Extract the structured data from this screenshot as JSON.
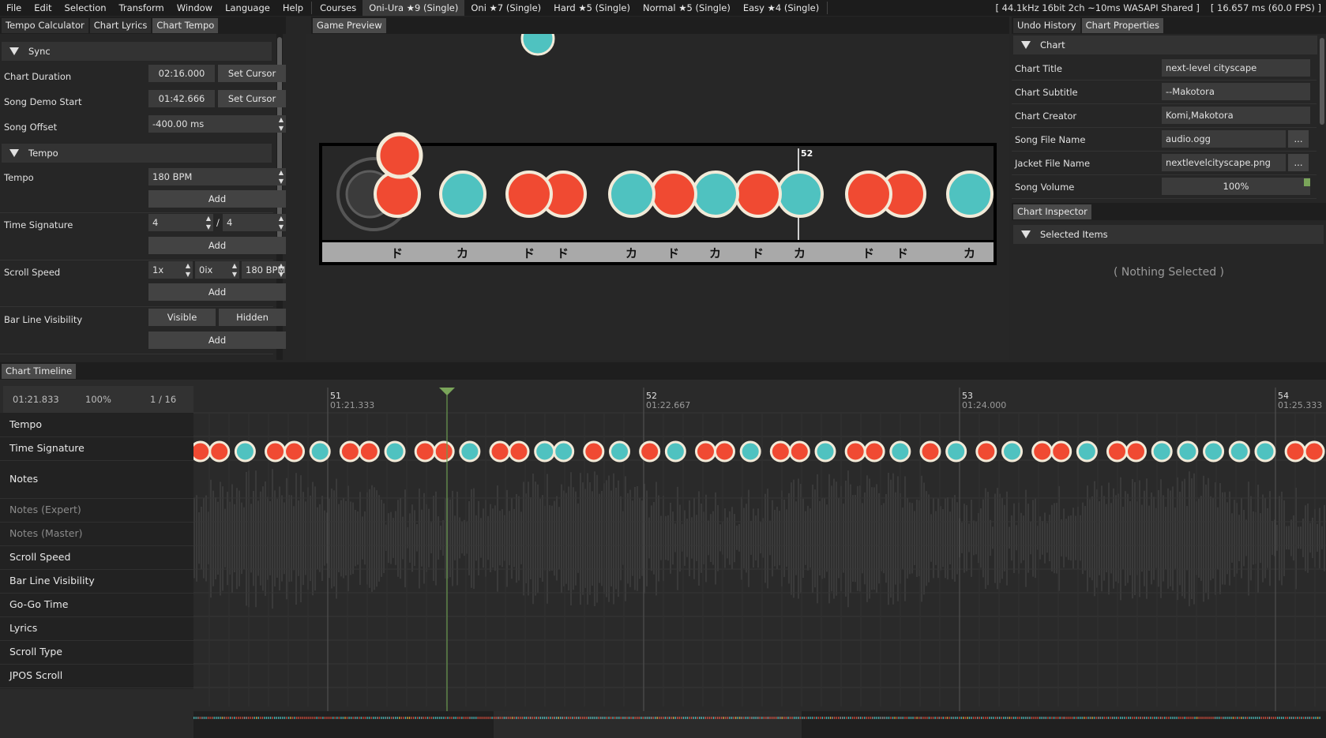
{
  "menu": [
    "File",
    "Edit",
    "Selection",
    "Transform",
    "Window",
    "Language",
    "Help"
  ],
  "courses": {
    "label": "Courses",
    "items": [
      "Oni-Ura ★9 (Single)",
      "Oni ★7 (Single)",
      "Hard ★5 (Single)",
      "Normal ★5 (Single)",
      "Easy ★4 (Single)"
    ],
    "selected_index": 0
  },
  "status": {
    "audio": "[ 44.1kHz 16bit 2ch ~10ms WASAPI Shared ]",
    "fps": "[ 16.657 ms (60.0 FPS) ]"
  },
  "left_tabs": [
    "Tempo Calculator",
    "Chart Lyrics",
    "Chart Tempo"
  ],
  "sync": {
    "header": "Sync",
    "chart_duration_label": "Chart Duration",
    "chart_duration": "02:16.000",
    "song_demo_label": "Song Demo Start",
    "song_demo": "01:42.666",
    "set_cursor": "Set Cursor",
    "offset_label": "Song Offset",
    "offset": "-400.00 ms"
  },
  "tempo": {
    "header": "Tempo",
    "tempo_label": "Tempo",
    "tempo_value": "180 BPM",
    "add": "Add",
    "timesig_label": "Time Signature",
    "timesig_num": "4",
    "timesig_slash": "/",
    "timesig_den": "4",
    "scroll_label": "Scroll Speed",
    "scroll_a": "1x",
    "scroll_b": "0ix",
    "scroll_c": "180 BPM",
    "barline_label": "Bar Line Visibility",
    "visible": "Visible",
    "hidden": "Hidden"
  },
  "game_preview": {
    "tab": "Game Preview",
    "bar_number": "52",
    "notes": [
      "red",
      "blue",
      "red",
      "red",
      "blue",
      "red",
      "blue",
      "red",
      "blue",
      "red",
      "red",
      "blue"
    ],
    "note_labels": [
      "ド",
      "カ",
      "ド",
      "ド",
      "カ",
      "ド",
      "カ",
      "ド",
      "カ",
      "ド",
      "ド",
      "カ"
    ]
  },
  "right_tabs": [
    "Undo History",
    "Chart Properties"
  ],
  "chart_props": {
    "header": "Chart",
    "rows": [
      {
        "label": "Chart Title",
        "value": "next-level cityscape"
      },
      {
        "label": "Chart Subtitle",
        "value": "--Makotora"
      },
      {
        "label": "Chart Creator",
        "value": "Komi,Makotora"
      },
      {
        "label": "Song File Name",
        "value": "audio.ogg"
      },
      {
        "label": "Jacket File Name",
        "value": "nextlevelcityscape.png"
      },
      {
        "label": "Song Volume",
        "value": "100%"
      }
    ],
    "browse": "..."
  },
  "inspector": {
    "tab": "Chart Inspector",
    "header": "Selected Items",
    "empty": "( Nothing Selected )"
  },
  "timeline": {
    "tab": "Chart Timeline",
    "cursor_time": "01:21.833",
    "zoom": "100%",
    "grid": "1 / 16",
    "markers": [
      {
        "bar": "51",
        "time": "01:21.333"
      },
      {
        "bar": "52",
        "time": "01:22.667"
      },
      {
        "bar": "53",
        "time": "01:24.000"
      },
      {
        "bar": "54",
        "time": "01:25.333"
      }
    ],
    "rows": [
      "Tempo",
      "Time Signature",
      "Notes",
      "Notes (Expert)",
      "Notes (Master)",
      "Scroll Speed",
      "Bar Line Visibility",
      "Go-Go Time",
      "Lyrics",
      "Scroll Type",
      "JPOS Scroll"
    ],
    "dim_rows": [
      3,
      4
    ],
    "notes": [
      "red",
      "red",
      "blue",
      "red",
      "red",
      "blue",
      "red",
      "red",
      "blue",
      "red",
      "red",
      "blue",
      "red",
      "red",
      "blue",
      "blue",
      "red",
      "blue",
      "red",
      "blue",
      "red",
      "red",
      "blue",
      "red",
      "red",
      "blue",
      "red",
      "red",
      "blue",
      "red",
      "blue",
      "red",
      "blue",
      "red",
      "red",
      "blue",
      "red",
      "red",
      "blue",
      "blue",
      "blue",
      "blue",
      "blue",
      "red",
      "red"
    ]
  },
  "colors": {
    "don": "#f04a32",
    "ka": "#4fc2c0",
    "rim": "#f2ead8",
    "accent": "#7aa55a"
  }
}
